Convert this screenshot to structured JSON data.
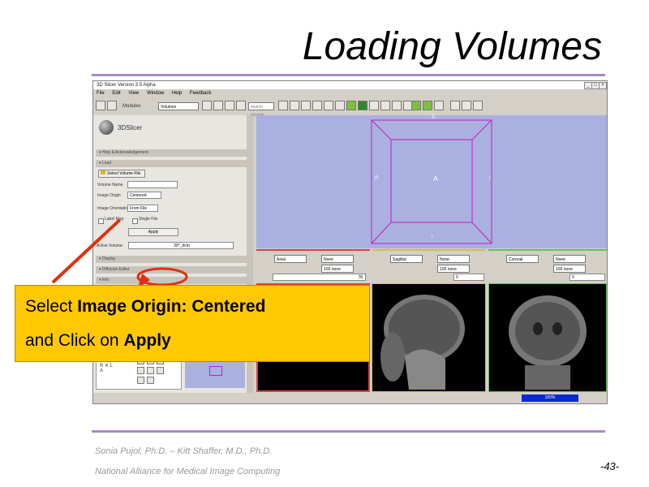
{
  "slide": {
    "title": "Loading Volumes",
    "footer_author": "Sonia Pujol, Ph.D. – Kitt Shaffer, M.D., Ph.D.",
    "footer_org": "National Alliance for Medical Image Computing",
    "page_number": "-43-"
  },
  "window": {
    "title": "3D Slicer Version 3.5 Alpha",
    "menu": [
      "File",
      "Edit",
      "View",
      "Window",
      "Help",
      "Feedback"
    ]
  },
  "toolbar": {
    "modules_label": "Modules",
    "module_value": "Volumes",
    "search_placeholder": "search module"
  },
  "left_panel": {
    "logo_text": "3DSlicer",
    "sections": {
      "help": "Help & Acknowledgement",
      "load": "Load",
      "display": "Display",
      "diffusion": "Diffusion Editor",
      "info": "Info"
    },
    "select_volume_button": "Select Volume File",
    "volume_name_label": "Volume Name",
    "image_origin_label": "Image Origin",
    "image_origin_value": "Centered",
    "image_orientation_label": "Image Orientation",
    "image_orientation_value": "From File",
    "label_map_label": "Label Map",
    "single_file_label": "Single File",
    "apply_button": "Apply",
    "active_volume_label": "Active Volume:",
    "active_volume_value": "30*_dcm"
  },
  "view3d": {
    "label_top": "S",
    "label_left": "R",
    "label_center": "A",
    "label_right": "I",
    "label_bottom": "I"
  },
  "slice_controls": [
    {
      "orientation": "Axial",
      "fg": "None",
      "opacity": "100 none",
      "value": "78"
    },
    {
      "orientation": "Sagittal",
      "fg": "None",
      "opacity": "100 none",
      "value": "0"
    },
    {
      "orientation": "Coronal",
      "fg": "None",
      "opacity": "100 none",
      "value": "0"
    }
  ],
  "status": {
    "progress": "100%"
  },
  "callout": {
    "line1_prefix": "Select ",
    "line1_bold": "Image Origin: Centered",
    "line2_prefix": "and Click on ",
    "line2_bold": "Apply"
  },
  "colors": {
    "accent_rule": "#a58bc9",
    "callout_bg": "#ffc800",
    "view3d_bg": "#aab0e0",
    "box_color": "#c020c0",
    "arrow_red": "#e03010"
  }
}
